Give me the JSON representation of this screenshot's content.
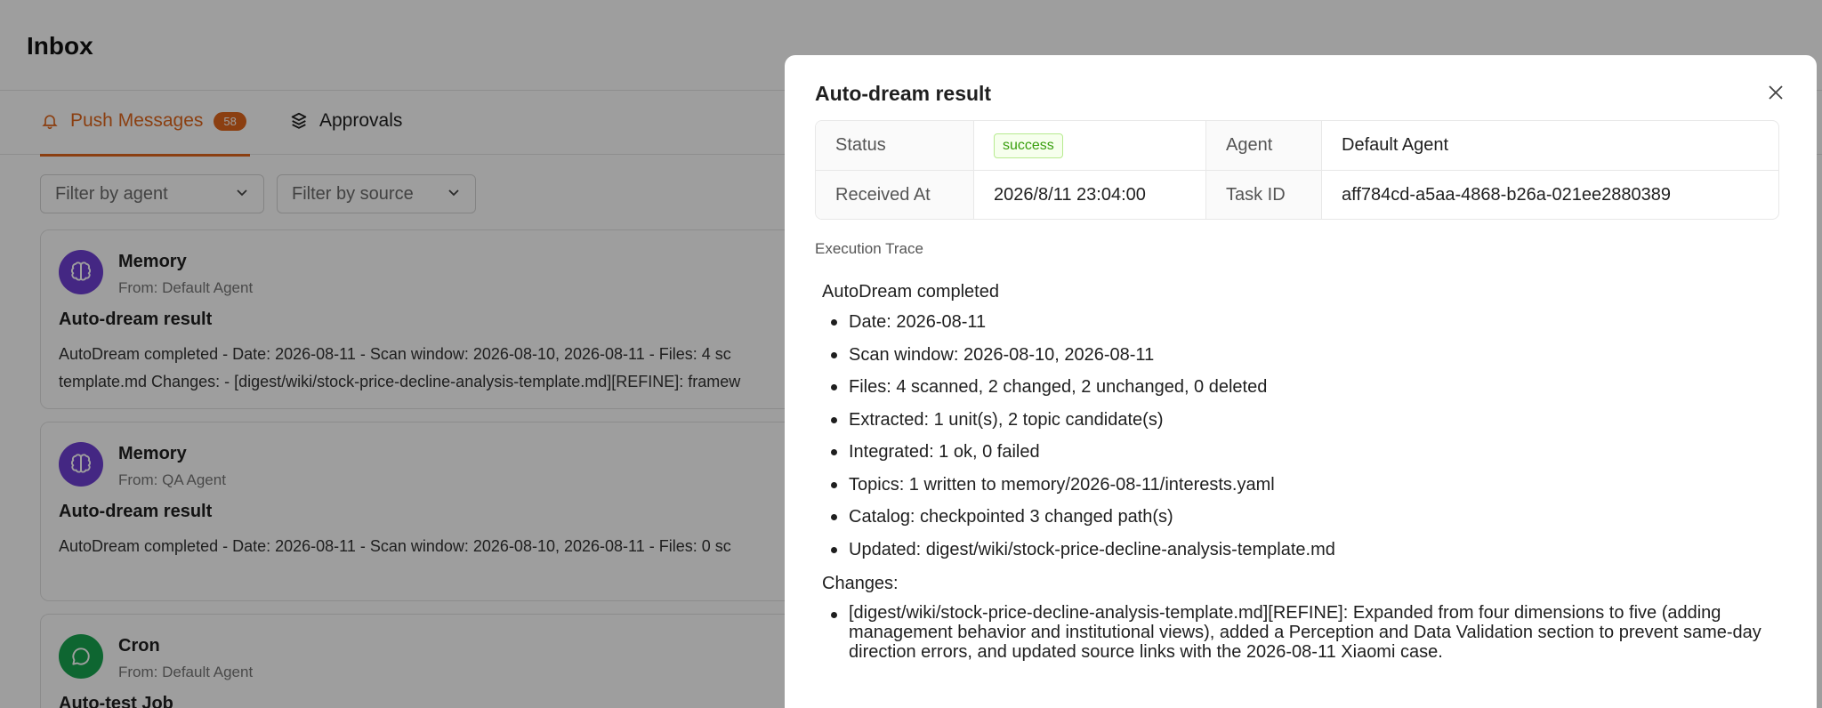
{
  "page": {
    "title": "Inbox",
    "tabs": [
      {
        "label": "Push Messages",
        "count": "58",
        "active": true
      },
      {
        "label": "Approvals",
        "active": false
      }
    ],
    "filters": {
      "agent_placeholder": "Filter by agent",
      "source_placeholder": "Filter by source"
    }
  },
  "messages": [
    {
      "type": "Memory",
      "from": "From: Default Agent",
      "title": "Auto-dream result",
      "line1": "AutoDream completed - Date: 2026-08-11 - Scan window: 2026-08-10, 2026-08-11 - Files: 4 sc",
      "line2": "template.md Changes: - [digest/wiki/stock-price-decline-analysis-template.md][REFINE]: framew",
      "icon": "brain-icon"
    },
    {
      "type": "Memory",
      "from": "From: QA Agent",
      "title": "Auto-dream result",
      "line1": "AutoDream completed - Date: 2026-08-11 - Scan window: 2026-08-10, 2026-08-11 - Files: 0 sc",
      "icon": "brain-icon"
    },
    {
      "type": "Cron",
      "from": "From: Default Agent",
      "title": "Auto-test Job",
      "icon": "chat-bubble-icon"
    }
  ],
  "modal": {
    "title": "Auto-dream result",
    "info": {
      "status_label": "Status",
      "status_value": "success",
      "agent_label": "Agent",
      "agent_value": "Default Agent",
      "received_label": "Received At",
      "received_value": "2026/8/11 23:04:00",
      "task_label": "Task ID",
      "task_value": "aff784cd-a5aa-4868-b26a-021ee2880389"
    },
    "trace_label": "Execution Trace",
    "trace_heading": "AutoDream completed",
    "trace_items": [
      "Date: 2026-08-11",
      "Scan window: 2026-08-10, 2026-08-11",
      "Files: 4 scanned, 2 changed, 2 unchanged, 0 deleted",
      "Extracted: 1 unit(s), 2 topic candidate(s)",
      "Integrated: 1 ok, 0 failed",
      "Topics: 1 written to memory/2026-08-11/interests.yaml",
      "Catalog: checkpointed 3 changed path(s)",
      "Updated: digest/wiki/stock-price-decline-analysis-template.md"
    ],
    "changes_heading": "Changes:",
    "changes_items": [
      "[digest/wiki/stock-price-decline-analysis-template.md][REFINE]: Expanded from four dimensions to five (adding management behavior and institutional views), added a Perception and Data Validation section to prevent same-day direction errors, and updated source links with the 2026-08-11 Xiaomi case."
    ]
  },
  "colors": {
    "accent": "#e0671c",
    "memory_avatar": "#6f3fd4",
    "cron_avatar": "#17a550",
    "success": "#389e0d"
  }
}
